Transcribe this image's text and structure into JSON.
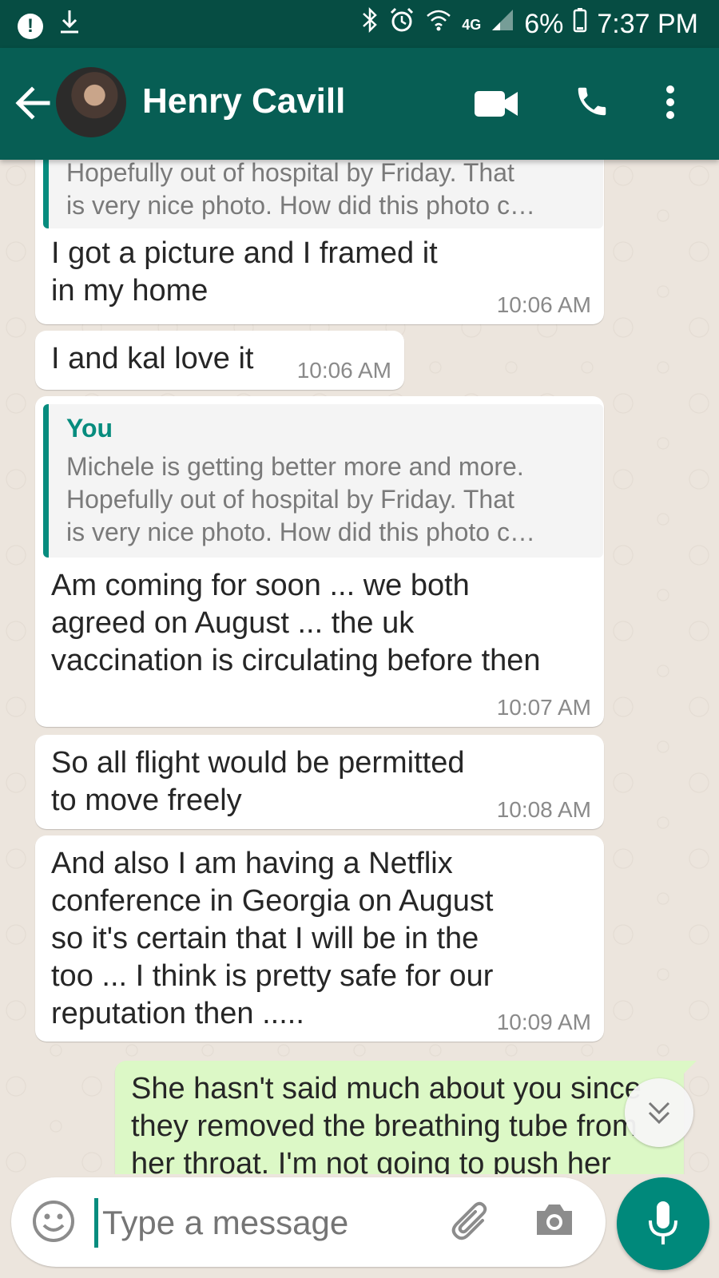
{
  "status_bar": {
    "battery": "6%",
    "time": "7:37 PM",
    "network": "4G"
  },
  "header": {
    "contact_name": "Henry Cavill"
  },
  "messages": [
    {
      "direction": "in",
      "quote_text": "Hopefully out of hospital by Friday. That\nis very nice photo.  How did this photo c…",
      "text": "I got a picture  and I framed it\nin my home",
      "time": "10:06 AM"
    },
    {
      "direction": "in",
      "text": "I and kal love it",
      "time": "10:06 AM"
    },
    {
      "direction": "in",
      "quote_sender": "You",
      "quote_text": "Michele is getting better more and more.\nHopefully out of hospital by Friday. That\nis very nice photo.  How did this photo c…",
      "text": "Am coming for soon ... we both\nagreed on August ... the uk\nvaccination is circulating before then",
      "time": "10:07 AM"
    },
    {
      "direction": "in",
      "text": "So all flight would be permitted\nto move freely",
      "time": "10:08 AM"
    },
    {
      "direction": "in",
      "text": "And also  I am having a Netflix\nconference in Georgia on August\nso  it's certain that  I will be in the\ntoo ... I think  is pretty safe for our\nreputation then .....",
      "time": "10:09 AM"
    },
    {
      "direction": "out",
      "text": "She hasn't said much about you since\nthey removed the breathing tube from\nher throat. I'm not going to push her"
    }
  ],
  "composer": {
    "placeholder": "Type a message"
  },
  "colors": {
    "header": "#075e54",
    "status_bar": "#064d43",
    "accent": "#00897b",
    "outgoing_bubble": "#dcf8c6"
  }
}
